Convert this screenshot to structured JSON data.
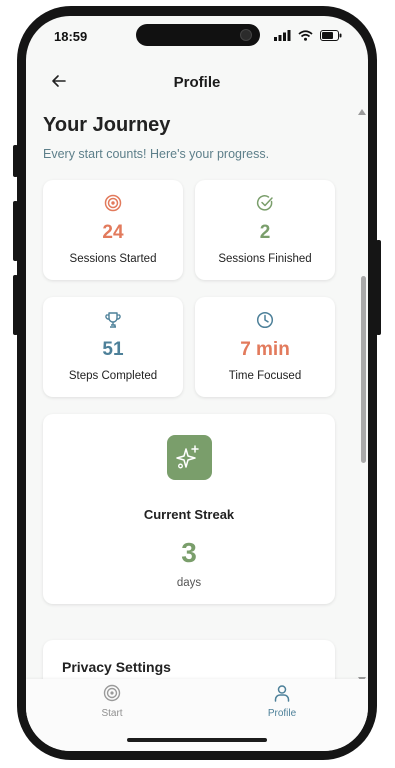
{
  "status_bar": {
    "time": "18:59"
  },
  "header": {
    "title": "Profile"
  },
  "journey": {
    "title": "Your Journey",
    "subtitle": "Every start counts! Here's your progress."
  },
  "stats": [
    {
      "value": "24",
      "label": "Sessions Started",
      "icon": "target-icon",
      "color": "#e27a5c"
    },
    {
      "value": "2",
      "label": "Sessions Finished",
      "icon": "check-circle-icon",
      "color": "#7a9e6b"
    },
    {
      "value": "51",
      "label": "Steps Completed",
      "icon": "trophy-icon",
      "color": "#4d8099"
    },
    {
      "value": "7 min",
      "label": "Time Focused",
      "icon": "clock-icon",
      "color": "#e27a5c"
    }
  ],
  "streak": {
    "label": "Current Streak",
    "value": "3",
    "unit": "days",
    "icon": "sparkles-icon"
  },
  "privacy": {
    "title": "Privacy Settings"
  },
  "tabs": [
    {
      "label": "Start",
      "icon": "target-icon",
      "active": false
    },
    {
      "label": "Profile",
      "icon": "user-icon",
      "active": true
    }
  ],
  "colors": {
    "accent_orange": "#e27a5c",
    "accent_green": "#7a9e6b",
    "accent_blue": "#4d8099",
    "subtitle": "#5d7f8a"
  }
}
